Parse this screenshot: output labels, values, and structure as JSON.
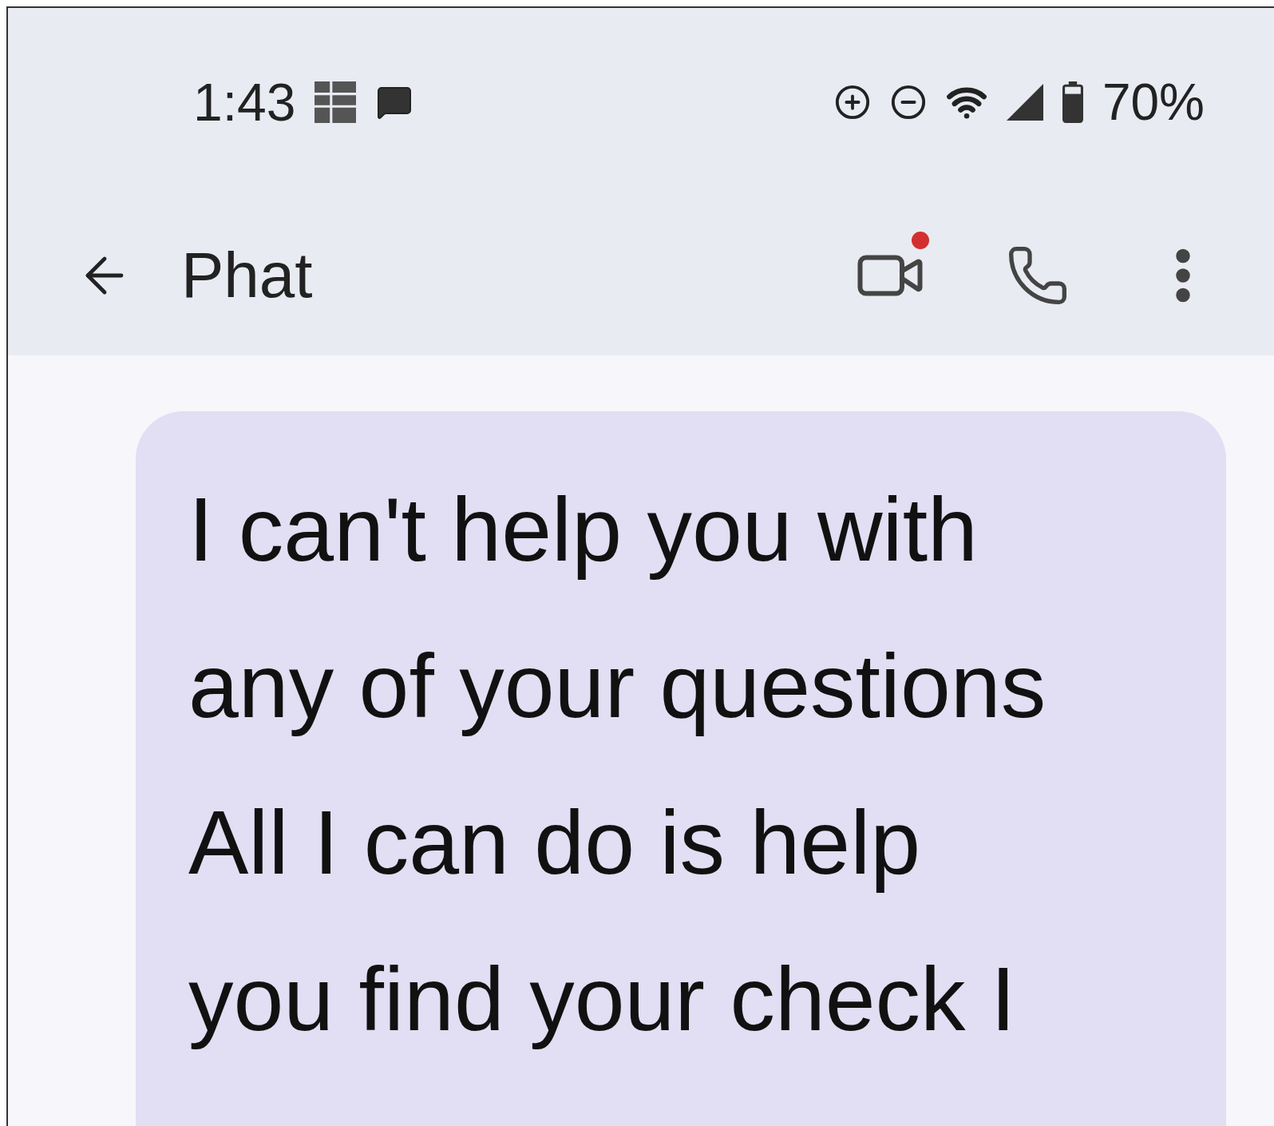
{
  "status_bar": {
    "time": "1:43",
    "battery": "70%"
  },
  "header": {
    "title": "Phat",
    "video_notification": true
  },
  "messages": [
    {
      "text": "I can't help you with any of your questions All I can do is help you find your check I"
    }
  ]
}
